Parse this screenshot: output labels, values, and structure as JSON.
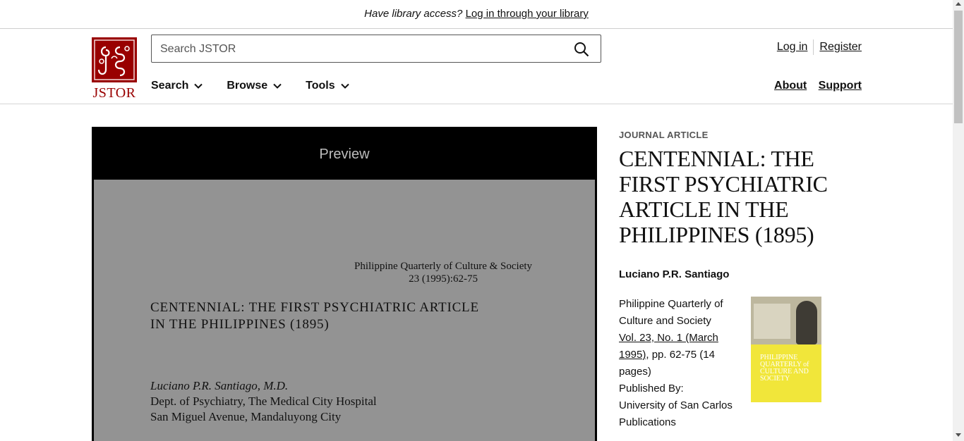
{
  "banner": {
    "question": "Have library access?",
    "link": "Log in through your library"
  },
  "header": {
    "logo_text": "JSTOR",
    "search": {
      "placeholder": "Search JSTOR",
      "value": ""
    },
    "nav": [
      "Search",
      "Browse",
      "Tools"
    ],
    "account": {
      "login": "Log in",
      "register": "Register"
    },
    "links": {
      "about": "About",
      "support": "Support"
    }
  },
  "preview": {
    "title": "Preview",
    "page": {
      "journal_line1": "Philippine Quarterly of Culture & Society",
      "journal_line2": "23 (1995):62-75",
      "title_line1": "CENTENNIAL: THE FIRST PSYCHIATRIC ARTICLE",
      "title_line2": "IN THE PHILIPPINES (1895)",
      "author": "Luciano P.R. Santiago, M.D.",
      "affil1": "Dept. of Psychiatry, The Medical City Hospital",
      "affil2": "San Miguel Avenue, Mandaluyong City"
    }
  },
  "article": {
    "type": "JOURNAL ARTICLE",
    "title": "CENTENNIAL: THE FIRST PSYCHIATRIC ARTICLE IN THE PHILIPPINES (1895)",
    "author": "Luciano P.R. Santiago",
    "journal": "Philippine Quarterly of Culture and Society",
    "issue": "Vol. 23, No. 1 (March 1995)",
    "pages": ", pp. 62-75 (14 pages)",
    "published_by_label": "Published By:",
    "publisher": "University of San Carlos Publications",
    "cover": {
      "title": "PHILIPPINE QUARTERLY of CULTURE AND SOCIETY"
    }
  },
  "colors": {
    "brand": "#990000",
    "cover": "#f1e63a",
    "preview_bg": "#939393"
  }
}
